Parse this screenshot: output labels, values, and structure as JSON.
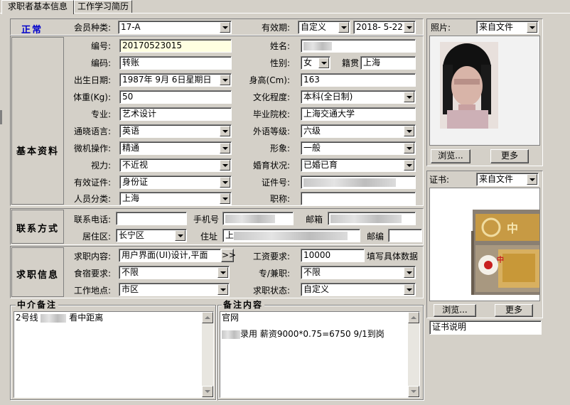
{
  "tabs": [
    "求职者基本信息",
    "工作学习简历"
  ],
  "status": "正常",
  "sections": {
    "basic": "基本资料",
    "contact": "联系方式",
    "job": "求职信息",
    "agent_notes": "中介备注",
    "remarks": "备注内容"
  },
  "labels": {
    "member_type": "会员种类:",
    "validity": "有效期:",
    "serial": "编号:",
    "name": "姓名:",
    "code": "编码:",
    "gender": "性别:",
    "native": "籍贯",
    "birthdate": "出生日期:",
    "height": "身高(Cm):",
    "weight": "体重(Kg):",
    "education": "文化程度:",
    "major": "专业:",
    "school": "毕业院校:",
    "language": "通晓语言:",
    "lang_level": "外语等级:",
    "computer": "微机操作:",
    "appearance": "形象:",
    "vision": "视力:",
    "marital": "婚育状况:",
    "id_type": "有效证件:",
    "id_no": "证件号:",
    "person_type": "人员分类:",
    "title": "职称:",
    "phone": "联系电话:",
    "mobile": "手机号",
    "email": "邮箱",
    "district": "居住区:",
    "address": "住址",
    "zip": "邮编",
    "job_content": "求职内容:",
    "salary": "工资要求:",
    "salary_hint": "填写具体数据",
    "board": "食宿要求:",
    "fulltime": "专/兼职:",
    "location": "工作地点:",
    "job_status": "求职状态:",
    "photo": "照片:",
    "certificate": "证书:"
  },
  "values": {
    "member_type": "17-A",
    "validity_type": "自定义",
    "validity_date": "2018- 5-22",
    "serial": "20170523015",
    "name": "",
    "code": "转账",
    "gender": "女",
    "native": "上海",
    "birthdate": "1987年 9月 6日星期日",
    "height": "163",
    "weight": "50",
    "education": "本科(全日制)",
    "major": "艺术设计",
    "school": "上海交通大学",
    "language": "英语",
    "lang_level": "六级",
    "computer": "精通",
    "appearance": "一般",
    "vision": "不近视",
    "marital": "已婚已育",
    "id_type": "身份证",
    "id_no": "",
    "person_type": "上海",
    "title": "",
    "phone": "",
    "mobile": "",
    "email": "",
    "district": "长宁区",
    "address": "上",
    "zip": "",
    "job_content": "用户界面(UI)设计,平面",
    "job_more": ">>",
    "salary": "10000",
    "board": "不限",
    "fulltime": "不限",
    "location": "市区",
    "job_status": "自定义",
    "photo_source": "来自文件",
    "cert_source": "来自文件",
    "cert_desc": "证书说明"
  },
  "buttons": {
    "photo_browse": "浏览...",
    "photo_more": "更多",
    "cert_browse": "浏览...",
    "cert_more": "更多"
  },
  "notes": {
    "agent_line_prefix": "2号线",
    "agent_line_suffix": "看中距离",
    "remark_line1": "官网",
    "remark_line2": "录用 薪资9000*0.75=6750 9/1到岗"
  },
  "cert_image_text": {
    "sign": "中",
    "logo": "中"
  },
  "colors": {
    "status_blue": "#0000cc",
    "face": "#d4d0c8",
    "highlight_input": "#ffffe1"
  }
}
